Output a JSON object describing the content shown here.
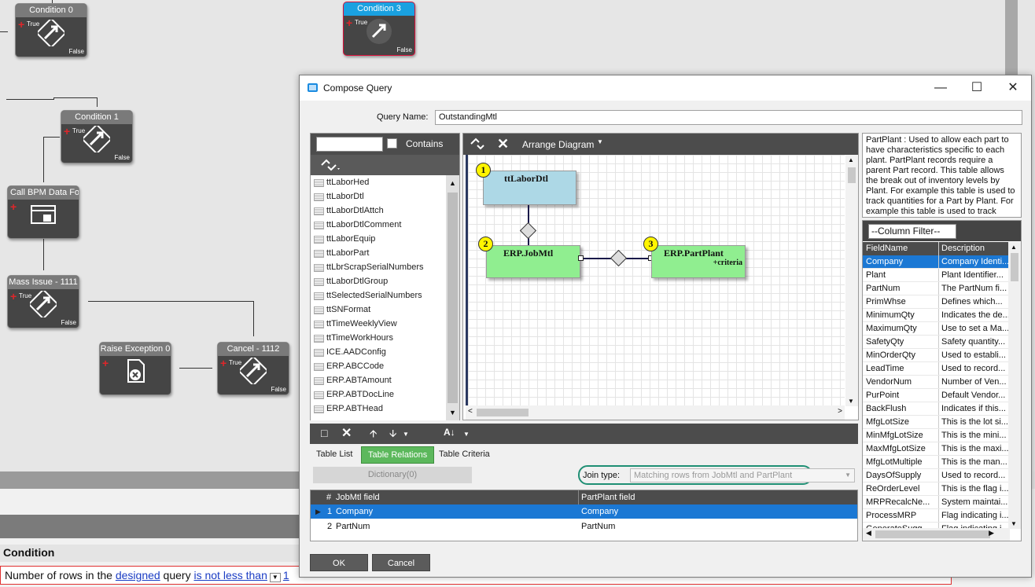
{
  "workflow": {
    "nodes": [
      {
        "title": "Condition 0",
        "true": "True",
        "false": "False"
      },
      {
        "title": "Condition 3",
        "true": "True",
        "false": "False"
      },
      {
        "title": "Condition 1",
        "true": "True",
        "false": "False"
      },
      {
        "title": "Call BPM Data Forr"
      },
      {
        "title": "Mass Issue - 1111",
        "true": "True",
        "false": "False"
      },
      {
        "title": "Raise Exception 0"
      },
      {
        "title": "Cancel - 1112",
        "true": "True",
        "false": "False"
      }
    ]
  },
  "condition": {
    "heading": "Condition",
    "text_pre": "Number of rows in the ",
    "link1": "designed",
    "text_mid": " query ",
    "link2": "is not less than",
    "value": "1"
  },
  "dialog": {
    "title": "Compose Query",
    "query_name_label": "Query Name:",
    "query_name": "OutstandingMtl",
    "contains_label": "Contains",
    "arrange_label": "Arrange Diagram",
    "tables": [
      "ttLaborHed",
      "ttLaborDtl",
      "ttLaborDtlAttch",
      "ttLaborDtlComment",
      "ttLaborEquip",
      "ttLaborPart",
      "ttLbrScrapSerialNumbers",
      "ttLaborDtlGroup",
      "ttSelectedSerialNumbers",
      "ttSNFormat",
      "ttTimeWeeklyView",
      "ttTimeWorkHours",
      "ICE.AADConfig",
      "ERP.ABCCode",
      "ERP.ABTAmount",
      "ERP.ABTDocLine",
      "ERP.ABTHead"
    ],
    "diagram": {
      "t1": {
        "num": "1",
        "name": "ttLaborDtl",
        "color": "#add8e6"
      },
      "t2": {
        "num": "2",
        "name": "ERP.JobMtl",
        "color": "#90ee90"
      },
      "t3": {
        "num": "3",
        "name": "ERP.PartPlant",
        "sub": "+criteria",
        "color": "#90ee90"
      }
    },
    "info": "PartPlant : Used to allow each part to have characteristics specific to each plant.  PartPlant records require a parent Part record.  This table allows the break out of inventory levels by Plant.  For example this table is used to track quantities for a Part by Plant.  For example this table is used to track quantities for a Part by Plant.",
    "column_filter": "--Column Filter--",
    "columns_header": {
      "field": "FieldName",
      "desc": "Description"
    },
    "columns": [
      {
        "field": "Company",
        "desc": "Company Identi..."
      },
      {
        "field": "Plant",
        "desc": "Plant Identifier..."
      },
      {
        "field": "PartNum",
        "desc": "The PartNum fi..."
      },
      {
        "field": "PrimWhse",
        "desc": "Defines which..."
      },
      {
        "field": "MinimumQty",
        "desc": "Indicates the de..."
      },
      {
        "field": "MaximumQty",
        "desc": "Use to set a Ma..."
      },
      {
        "field": "SafetyQty",
        "desc": "Safety quantity..."
      },
      {
        "field": "MinOrderQty",
        "desc": "Used to establi..."
      },
      {
        "field": "LeadTime",
        "desc": "Used to record..."
      },
      {
        "field": "VendorNum",
        "desc": "Number of Ven..."
      },
      {
        "field": "PurPoint",
        "desc": "Default Vendor..."
      },
      {
        "field": "BackFlush",
        "desc": "Indicates if this..."
      },
      {
        "field": "MfgLotSize",
        "desc": "This is the lot si..."
      },
      {
        "field": "MinMfgLotSize",
        "desc": "This is the mini..."
      },
      {
        "field": "MaxMfgLotSize",
        "desc": "This is the maxi..."
      },
      {
        "field": "MfgLotMultiple",
        "desc": "This is the man..."
      },
      {
        "field": "DaysOfSupply",
        "desc": "Used to record..."
      },
      {
        "field": "ReOrderLevel",
        "desc": "This is the flag i..."
      },
      {
        "field": "MRPRecalcNe...",
        "desc": "System maintai..."
      },
      {
        "field": "ProcessMRP",
        "desc": "Flag indicating i..."
      },
      {
        "field": "GenerateSugg...",
        "desc": "Flag indicating i..."
      }
    ],
    "tabs": {
      "list": "Table List",
      "relations": "Table Relations",
      "criteria": "Table Criteria"
    },
    "dictionary_label": "Dictionary(0)",
    "join_type_label": "Join type:",
    "join_type_value": "Matching rows from JobMtl and PartPlant",
    "relations_header": {
      "num": "#",
      "left": "JobMtl field",
      "right": "PartPlant field"
    },
    "relations": [
      {
        "num": "1",
        "left": "Company",
        "right": "Company"
      },
      {
        "num": "2",
        "left": "PartNum",
        "right": "PartNum"
      }
    ],
    "ok_label": "OK",
    "cancel_label": "Cancel"
  }
}
